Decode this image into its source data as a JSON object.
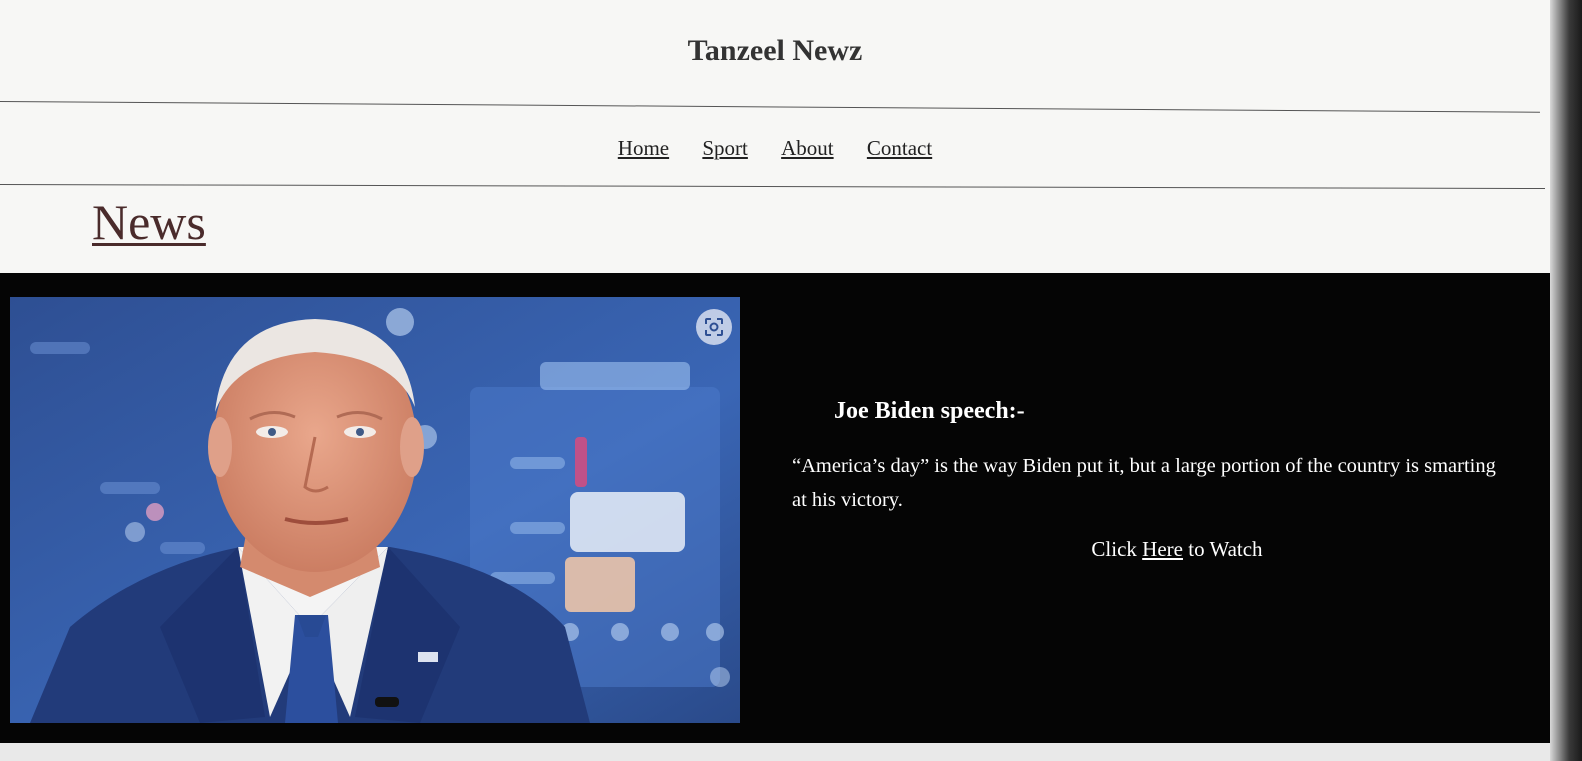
{
  "site": {
    "title": "Tanzeel Newz"
  },
  "nav": {
    "items": [
      {
        "label": "Home"
      },
      {
        "label": "Sport"
      },
      {
        "label": "About"
      },
      {
        "label": "Contact"
      }
    ]
  },
  "section": {
    "heading": "News"
  },
  "article": {
    "image_icon": "person-photo",
    "image_overlay_icon": "lens-scan-icon",
    "title": "Joe Biden speech:-",
    "body": "“America’s day” is the way Biden put it, but a large portion of the country is smarting at his victory.",
    "cta_prefix": "Click ",
    "cta_link": "Here",
    "cta_suffix": " to Watch"
  },
  "colors": {
    "page_background": "#f7f7f5",
    "article_background": "#050505",
    "heading_color": "#4a2b2b",
    "article_text": "#ffffff"
  }
}
